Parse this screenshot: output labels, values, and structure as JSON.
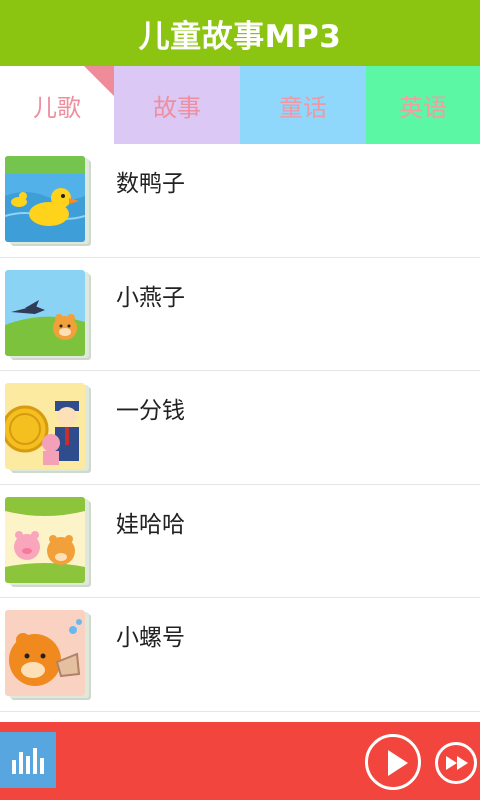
{
  "app": {
    "title": "儿童故事MP3"
  },
  "tabs": [
    {
      "label": "儿歌",
      "selected": true
    },
    {
      "label": "故事",
      "selected": false
    },
    {
      "label": "童话",
      "selected": false
    },
    {
      "label": "英语",
      "selected": false
    }
  ],
  "songs": [
    {
      "title": "数鸭子",
      "icon": "duck-thumbnail"
    },
    {
      "title": "小燕子",
      "icon": "swallow-thumbnail"
    },
    {
      "title": "一分钱",
      "icon": "coin-thumbnail"
    },
    {
      "title": "娃哈哈",
      "icon": "kids-thumbnail"
    },
    {
      "title": "小螺号",
      "icon": "conch-thumbnail"
    }
  ],
  "player": {
    "playlist_icon": "equalizer-icon",
    "play_icon": "play-icon",
    "next_icon": "fast-forward-icon"
  },
  "colors": {
    "header": "#8cc412",
    "tab_story": "#dcc8f5",
    "tab_fairy": "#8fd8fb",
    "tab_english": "#5cf7a5",
    "tab_text": "#ef8f9e",
    "player_bar": "#f2453d",
    "playlist_button": "#58a6e0"
  }
}
